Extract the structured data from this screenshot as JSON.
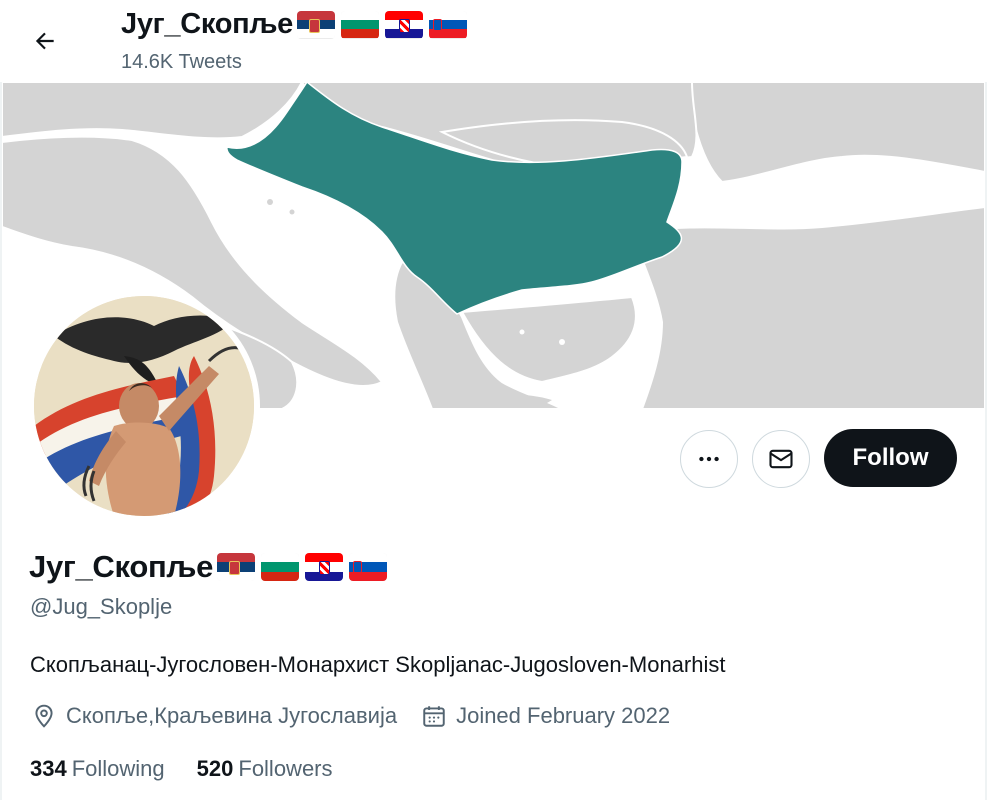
{
  "header": {
    "display_name": "Југ_Скопље",
    "tweet_count": "14.6K Tweets"
  },
  "flags": [
    "serbia-flag-icon",
    "bulgaria-flag-icon",
    "croatia-flag-icon",
    "slovenia-flag-icon"
  ],
  "colors": {
    "map_highlight": "#2c8480",
    "map_land": "#d4d4d4",
    "map_sea": "#ffffff",
    "follow_button": "#0f1419",
    "secondary_text": "#536471"
  },
  "actions": {
    "more_icon": "more-icon",
    "message_icon": "envelope-icon",
    "follow_label": "Follow"
  },
  "profile": {
    "display_name": "Југ_Скопље",
    "handle": "@Jug_Skoplje",
    "bio": "Скопљанац-Југословен-Монархист Skopljanac-Jugosloven-Monarhist",
    "location": "Скопље,Краљевина Југославија",
    "joined": "Joined February 2022",
    "following_count": "334",
    "following_label": "Following",
    "followers_count": "520",
    "followers_label": "Followers"
  }
}
